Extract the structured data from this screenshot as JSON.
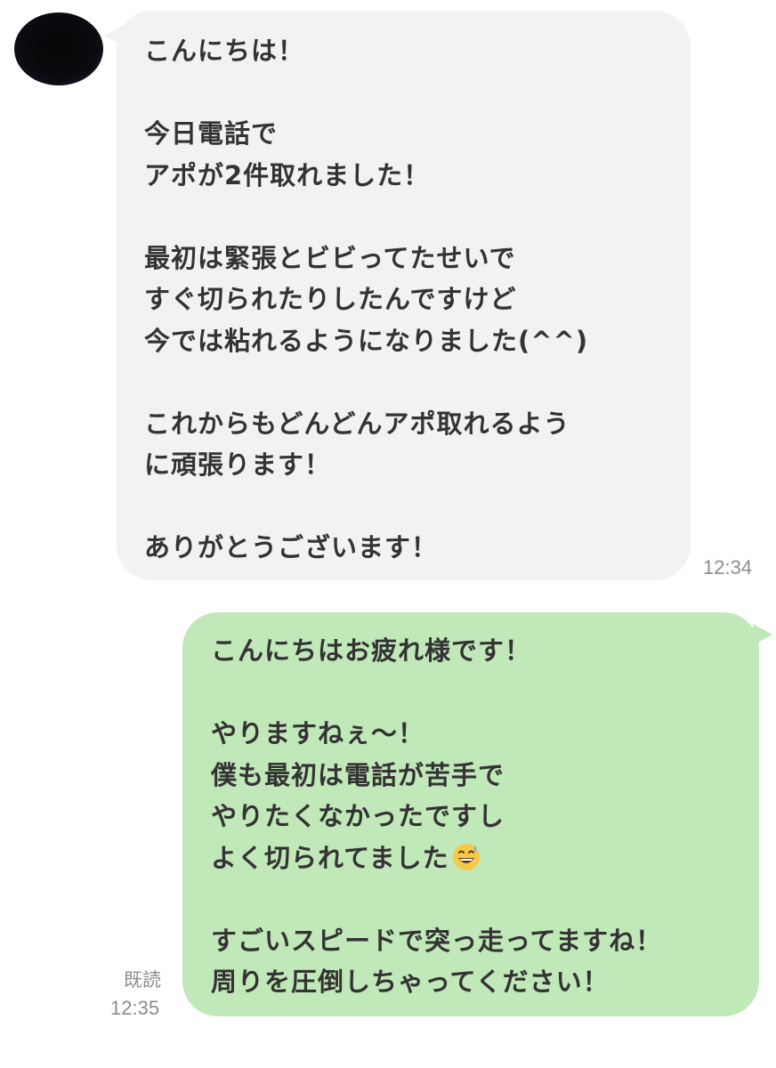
{
  "chat": {
    "incoming": {
      "lines": [
        "こんにちは！",
        "",
        "今日電話で",
        "アポが2件取れました！",
        "",
        "最初は緊張とビビってたせいで",
        "すぐ切られたりしたんですけど",
        "今では粘れるようになりました(^^)",
        "",
        "これからもどんどんアポ取れるよう",
        "に頑張ります！",
        "",
        "ありがとうございます！"
      ],
      "time": "12:34"
    },
    "outgoing": {
      "lines": [
        "こんにちはお疲れ様です！",
        "",
        "やりますねぇ〜！",
        "僕も最初は電話が苦手で",
        "やりたくなかったですし",
        "よく切られてました",
        "",
        "すごいスピードで突っ走ってますね！",
        "周りを圧倒しちゃってください！"
      ],
      "emoji": "grinning-sweat-emoji",
      "read_label": "既読",
      "time": "12:35"
    }
  }
}
